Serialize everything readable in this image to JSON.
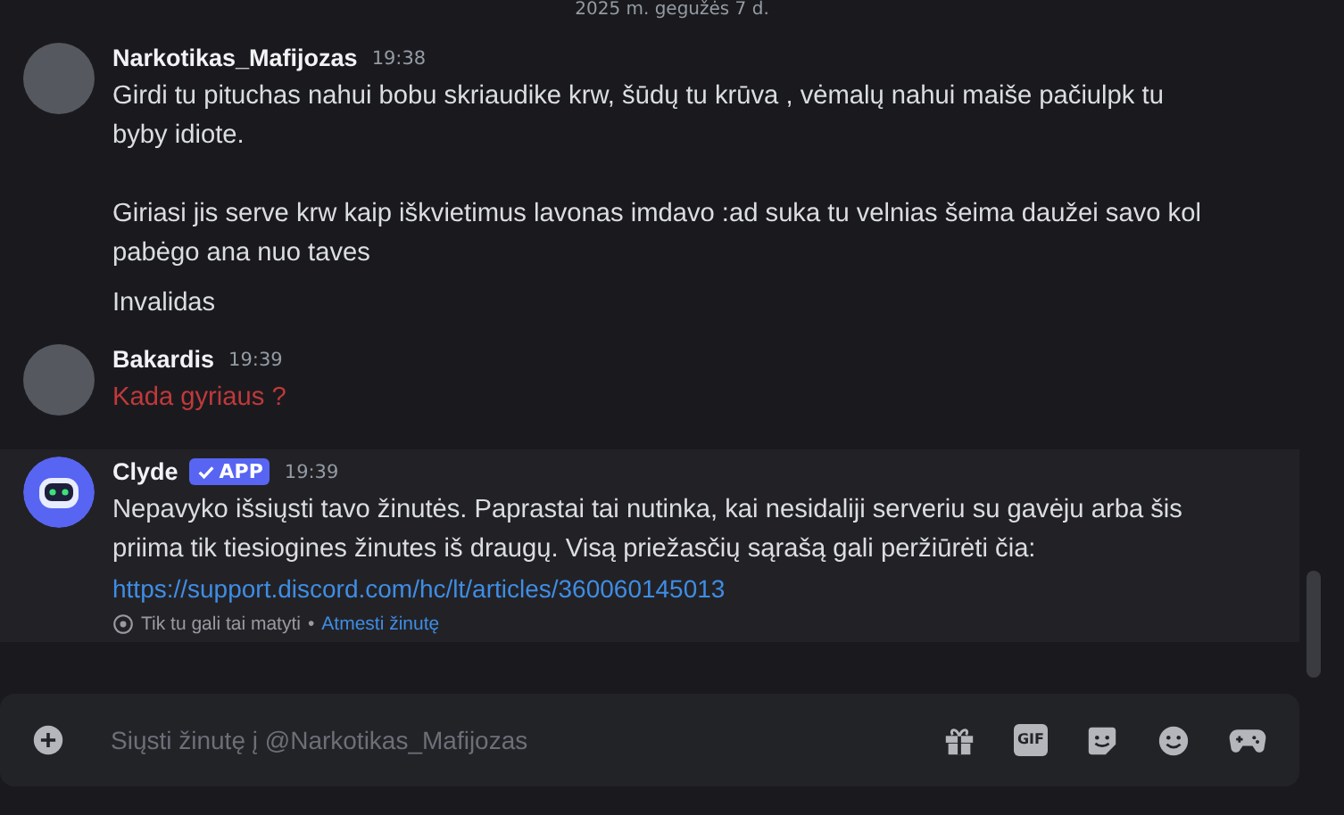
{
  "date_divider": "2025 m. gegužės 7 d.",
  "messages": [
    {
      "author": "Narkotikas_Mafijozas",
      "time": "19:38",
      "kind": "normal",
      "text": "Girdi tu pituchas nahui bobu skriaudike krw, šūdų tu krūva , vėmalų nahui maiše pačiulpk tu byby idiote.\n\nGiriasi jis serve krw kaip iškvietimus lavonas imdavo :ad suka tu velnias šeima daužei savo kol pabėgo ana nuo taves"
    },
    {
      "kind": "continuation",
      "text": "Invalidas"
    },
    {
      "author": "Bakardis",
      "time": "19:39",
      "kind": "normal",
      "color": "#c0393b",
      "text": "Kada gyriaus ?"
    },
    {
      "author": "Clyde",
      "time": "19:39",
      "kind": "system",
      "badge": "APP",
      "text": "Nepavyko išsiųsti tavo žinutės. Paprastai tai nutinka, kai nesidaliji serveriu su gavėju arba šis priima tik tiesiogines žinutes iš draugų. Visą priežasčių sąrašą gali peržiūrėti čia:",
      "link": "https://support.discord.com/hc/lt/articles/360060145013",
      "note": "Tik tu gali tai matyti",
      "note_separator": "•",
      "dismiss": "Atmesti žinutę"
    }
  ],
  "composer": {
    "placeholder": "Siųsti žinutę į @Narkotikas_Mafijozas",
    "gif_label": "GIF"
  }
}
